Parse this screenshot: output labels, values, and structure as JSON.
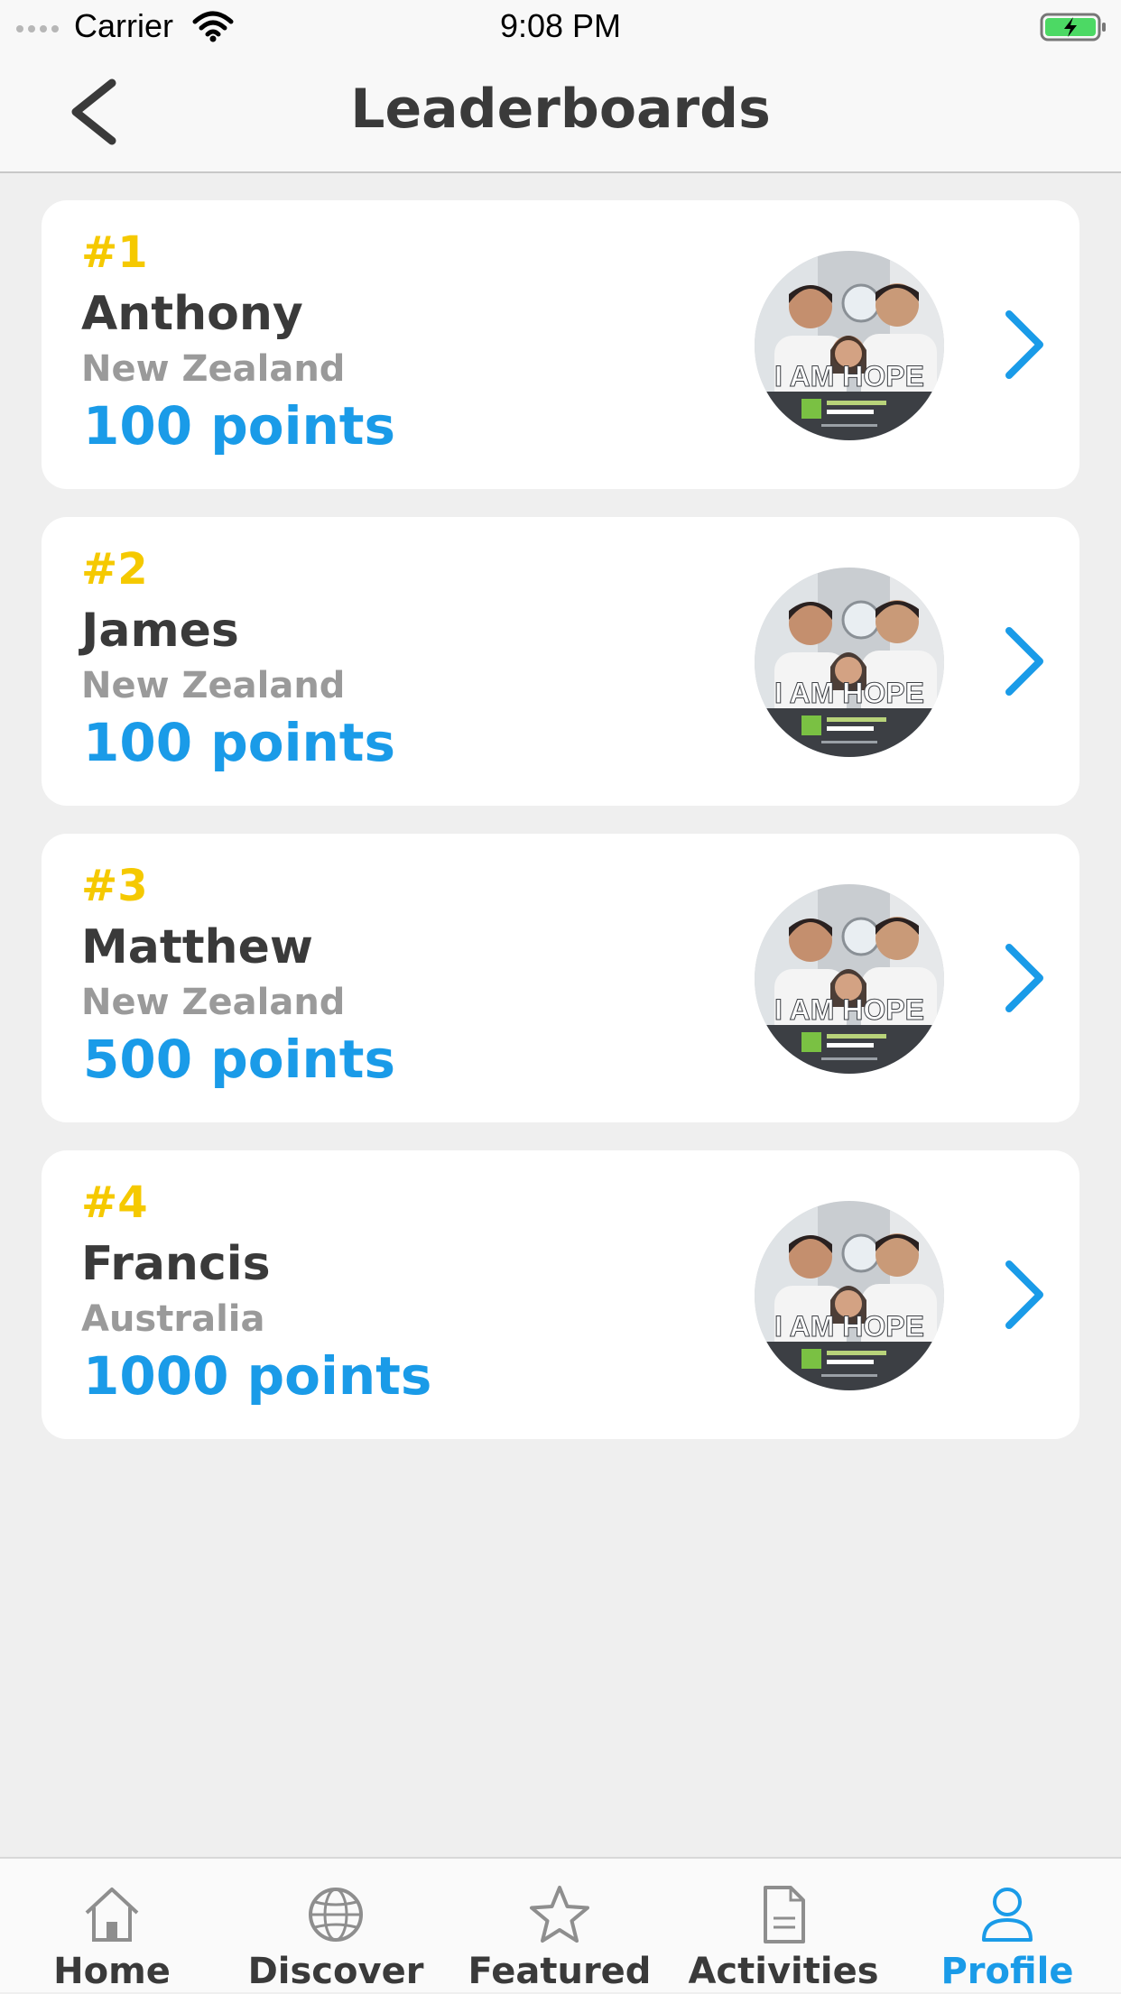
{
  "status_bar": {
    "carrier": "Carrier",
    "time": "9:08 PM"
  },
  "header": {
    "title": "Leaderboards"
  },
  "leaderboard": [
    {
      "rank": "#1",
      "name": "Anthony",
      "country": "New Zealand",
      "points": "100 points",
      "image_text": "I AM HOPE"
    },
    {
      "rank": "#2",
      "name": "James",
      "country": "New Zealand",
      "points": "100 points",
      "image_text": "I AM HOPE"
    },
    {
      "rank": "#3",
      "name": "Matthew",
      "country": "New Zealand",
      "points": "500 points",
      "image_text": "I AM HOPE"
    },
    {
      "rank": "#4",
      "name": "Francis",
      "country": "Australia",
      "points": "1000 points",
      "image_text": "I AM HOPE"
    }
  ],
  "tab_bar": {
    "items": [
      {
        "label": "Home",
        "icon": "home-icon"
      },
      {
        "label": "Discover",
        "icon": "globe-icon"
      },
      {
        "label": "Featured",
        "icon": "star-icon"
      },
      {
        "label": "Activities",
        "icon": "document-icon"
      },
      {
        "label": "Profile",
        "icon": "person-icon"
      }
    ],
    "active": "Profile"
  },
  "colors": {
    "accent": "#1a9be8",
    "rank": "#f5c900",
    "text_primary": "#3a3a3a",
    "text_secondary": "#9a9a9a",
    "background": "#efefef"
  }
}
